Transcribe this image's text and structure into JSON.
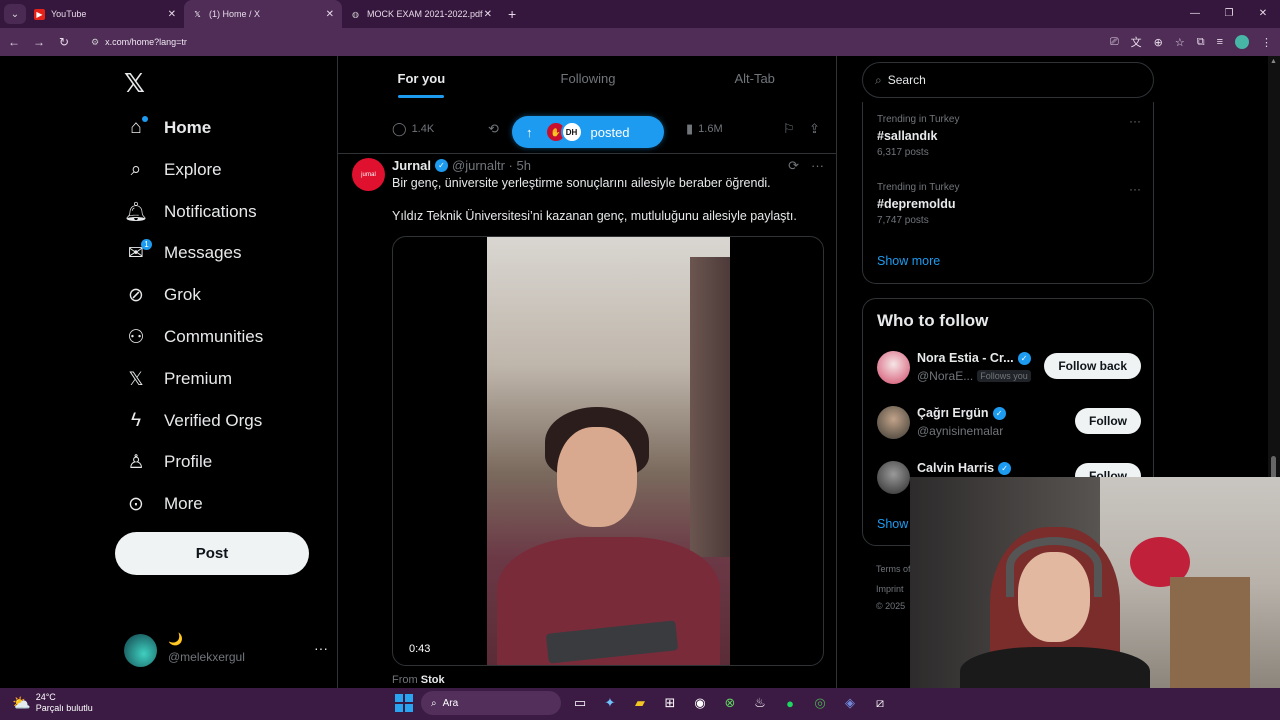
{
  "browser": {
    "tabs": [
      {
        "title": "YouTube",
        "favicon": "youtube-icon"
      },
      {
        "title": "(1) Home / X",
        "favicon": "x-logo-icon"
      },
      {
        "title": "MOCK EXAM 2021-2022.pdf",
        "favicon": "globe-icon"
      }
    ],
    "url": "x.com/home?lang=tr"
  },
  "nav": {
    "items": [
      {
        "label": "Home",
        "icon": "home-icon"
      },
      {
        "label": "Explore",
        "icon": "search-icon"
      },
      {
        "label": "Notifications",
        "icon": "bell-icon"
      },
      {
        "label": "Messages",
        "icon": "mail-icon",
        "badge": "1"
      },
      {
        "label": "Grok",
        "icon": "grok-icon"
      },
      {
        "label": "Communities",
        "icon": "communities-icon"
      },
      {
        "label": "Premium",
        "icon": "x-logo-icon"
      },
      {
        "label": "Verified Orgs",
        "icon": "lightning-icon"
      },
      {
        "label": "Profile",
        "icon": "person-icon"
      },
      {
        "label": "More",
        "icon": "more-circle-icon"
      }
    ],
    "post_label": "Post",
    "account": {
      "name": "🌙",
      "handle": "@melekxergul"
    }
  },
  "feed": {
    "tabs": [
      "For you",
      "Following",
      "Alt-Tab"
    ],
    "prev_metrics": {
      "replies": "1.4K",
      "views": "1.6M"
    },
    "posted_pill": {
      "text": "posted",
      "av2": "DH"
    },
    "tweet": {
      "author": "Jurnal",
      "handle_time": "@jurnaltr · 5h",
      "avatar_text": "jurnal",
      "text1": "Bir genç, üniversite yerleştirme sonuçlarını ailesiyle beraber öğrendi.",
      "text2": "Yıldız Teknik Üniversitesi’ni kazanan genç, mutluluğunu ailesiyle paylaştı.",
      "duration": "0:43",
      "source_prefix": "From",
      "source_name": "Stok"
    }
  },
  "sidebar": {
    "search_placeholder": "Search",
    "trends": [
      {
        "context": "Trending in Turkey",
        "tag": "#sallandık",
        "count": "6,317 posts"
      },
      {
        "context": "Trending in Turkey",
        "tag": "#depremoldu",
        "count": "7,747 posts"
      }
    ],
    "show_more": "Show more",
    "who_to_follow": {
      "title": "Who to follow",
      "users": [
        {
          "name": "Nora Estia - Cr...",
          "handle": "@NoraE...",
          "follows_you": "Follows you",
          "button": "Follow back"
        },
        {
          "name": "Çağrı Ergün",
          "handle": "@aynisinemalar",
          "button": "Follow"
        },
        {
          "name": "Calvin Harris",
          "handle": "",
          "button": "Follow"
        }
      ],
      "show_more": "Show"
    },
    "footer": [
      "Terms of",
      "Imprint",
      "© 2025"
    ]
  },
  "taskbar": {
    "temp": "24°C",
    "weather": "Parçalı bulutlu",
    "search": "Ara"
  },
  "colors": {
    "accent": "#1d9bf0",
    "bg": "#000000",
    "chrome": "#4f2d57"
  }
}
